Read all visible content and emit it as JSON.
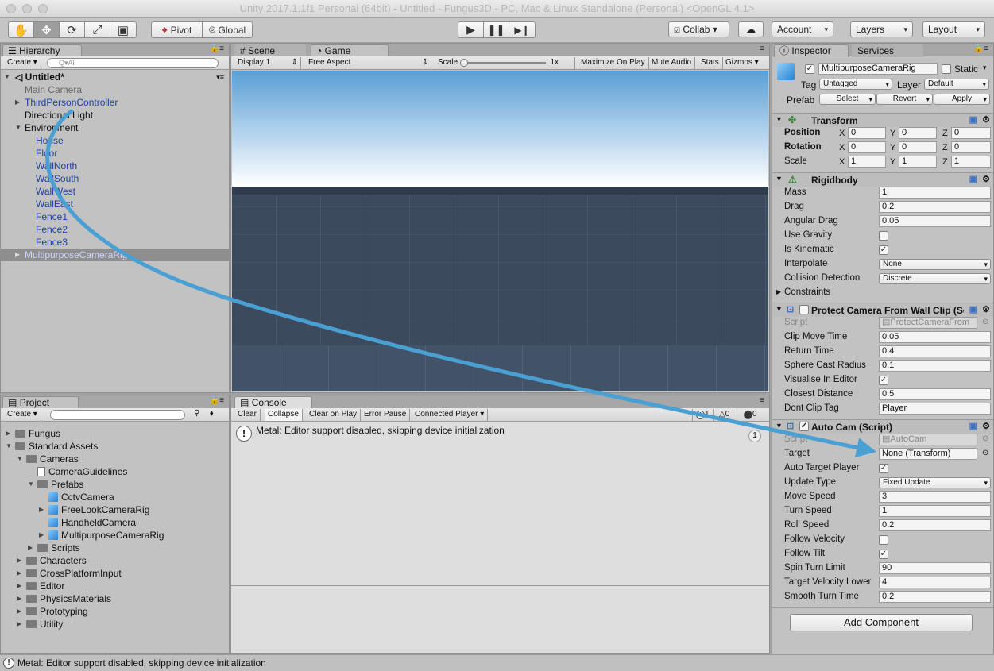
{
  "window": {
    "title": "Unity 2017.1.1f1 Personal (64bit) - Untitled - Fungus3D - PC, Mac & Linux Standalone (Personal) <OpenGL 4.1>"
  },
  "toolbar": {
    "pivot": "Pivot",
    "global": "Global",
    "collab": "Collab ▾",
    "account": "Account",
    "layers": "Layers",
    "layout": "Layout"
  },
  "hierarchy": {
    "tab": "Hierarchy",
    "create": "Create",
    "search_placeholder": "Q▾All",
    "scene": "Untitled*",
    "items": [
      "Main Camera",
      "ThirdPersonController",
      "Directional Light",
      "Environment",
      "House",
      "Floor",
      "WallNorth",
      "WallSouth",
      "WallWest",
      "WallEast",
      "Fence1",
      "Fence2",
      "Fence3",
      "MultipurposeCameraRig"
    ]
  },
  "scene_tabs": {
    "scene": "Scene",
    "game": "Game"
  },
  "game_bar": {
    "display": "Display 1",
    "aspect": "Free Aspect",
    "scale": "Scale",
    "scale_val": "1x",
    "maximize": "Maximize On Play",
    "mute": "Mute Audio",
    "stats": "Stats",
    "gizmos": "Gizmos"
  },
  "project": {
    "tab": "Project",
    "create": "Create",
    "items": [
      "Fungus",
      "Standard Assets",
      "Cameras",
      "CameraGuidelines",
      "Prefabs",
      "CctvCamera",
      "FreeLookCameraRig",
      "HandheldCamera",
      "MultipurposeCameraRig",
      "Scripts",
      "Characters",
      "CrossPlatformInput",
      "Editor",
      "PhysicsMaterials",
      "Prototyping",
      "Utility"
    ]
  },
  "console": {
    "tab": "Console",
    "clear": "Clear",
    "collapse": "Collapse",
    "clear_on_play": "Clear on Play",
    "error_pause": "Error Pause",
    "connected": "Connected Player",
    "count_info": "1",
    "count_warn": "0",
    "count_err": "0",
    "message": "Metal: Editor support disabled, skipping device initialization",
    "msg_count": "1"
  },
  "inspector": {
    "tab": "Inspector",
    "services": "Services",
    "object_name": "MultipurposeCameraRig",
    "static": "Static",
    "tag_label": "Tag",
    "tag": "Untagged",
    "layer_label": "Layer",
    "layer": "Default",
    "prefab_label": "Prefab",
    "select": "Select",
    "revert": "Revert",
    "apply": "Apply",
    "transform": {
      "title": "Transform",
      "position": "Position",
      "rotation": "Rotation",
      "scale": "Scale",
      "x": "X",
      "y": "Y",
      "z": "Z",
      "pos": [
        "0",
        "0",
        "0"
      ],
      "rot": [
        "0",
        "0",
        "0"
      ],
      "scl": [
        "1",
        "1",
        "1"
      ]
    },
    "rigidbody": {
      "title": "Rigidbody",
      "mass_l": "Mass",
      "mass": "1",
      "drag_l": "Drag",
      "drag": "0.2",
      "adrag_l": "Angular Drag",
      "adrag": "0.05",
      "grav_l": "Use Gravity",
      "kin_l": "Is Kinematic",
      "interp_l": "Interpolate",
      "interp": "None",
      "coll_l": "Collision Detection",
      "coll": "Discrete",
      "constraints": "Constraints"
    },
    "protect": {
      "title": "Protect Camera From Wall Clip (Sc",
      "script_l": "Script",
      "script": "ProtectCameraFrom",
      "clip_l": "Clip Move Time",
      "clip": "0.05",
      "ret_l": "Return Time",
      "ret": "0.4",
      "sph_l": "Sphere Cast Radius",
      "sph": "0.1",
      "vis_l": "Visualise In Editor",
      "close_l": "Closest Distance",
      "close": "0.5",
      "tag_l": "Dont Clip Tag",
      "tag": "Player"
    },
    "autocam": {
      "title": "Auto Cam (Script)",
      "script_l": "Script",
      "script": "AutoCam",
      "target_l": "Target",
      "target": "None (Transform)",
      "atp_l": "Auto Target Player",
      "upd_l": "Update Type",
      "upd": "Fixed Update",
      "move_l": "Move Speed",
      "move": "3",
      "turn_l": "Turn Speed",
      "turn": "1",
      "roll_l": "Roll Speed",
      "roll": "0.2",
      "fv_l": "Follow Velocity",
      "ft_l": "Follow Tilt",
      "spin_l": "Spin Turn Limit",
      "spin": "90",
      "tvl_l": "Target Velocity Lower",
      "tvl": "4",
      "stt_l": "Smooth Turn Time",
      "stt": "0.2"
    },
    "add_component": "Add Component"
  },
  "statusbar": {
    "message": "Metal: Editor support disabled, skipping device initialization"
  },
  "colors": {
    "arrow": "#4a9fd3",
    "selection": "#8e8e8e",
    "blue_text": "#1c3fa5"
  }
}
